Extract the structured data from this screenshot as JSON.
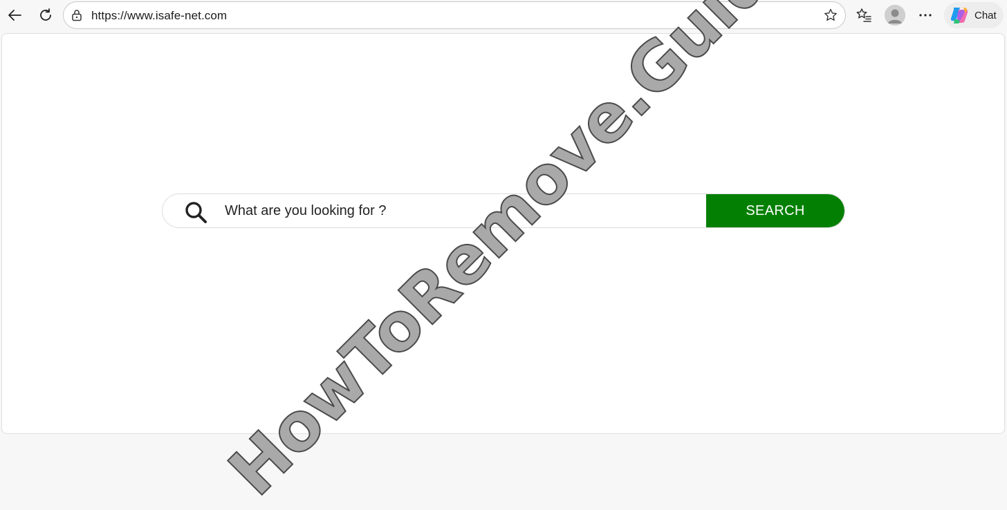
{
  "browser": {
    "url": "https://www.isafe-net.com",
    "chat_label": "Chat",
    "icons": {
      "back": "arrow-left-icon",
      "reload": "reload-icon",
      "lock": "lock-icon",
      "favorite": "star-icon",
      "favorites_list": "favorites-list-icon",
      "profile": "profile-avatar",
      "more": "more-dots-icon",
      "copilot": "copilot-icon"
    }
  },
  "search": {
    "placeholder": "What are you looking for ?",
    "button_label": "SEARCH",
    "button_color": "#038003"
  },
  "watermark": {
    "text": "HowToRemove.Guide"
  }
}
